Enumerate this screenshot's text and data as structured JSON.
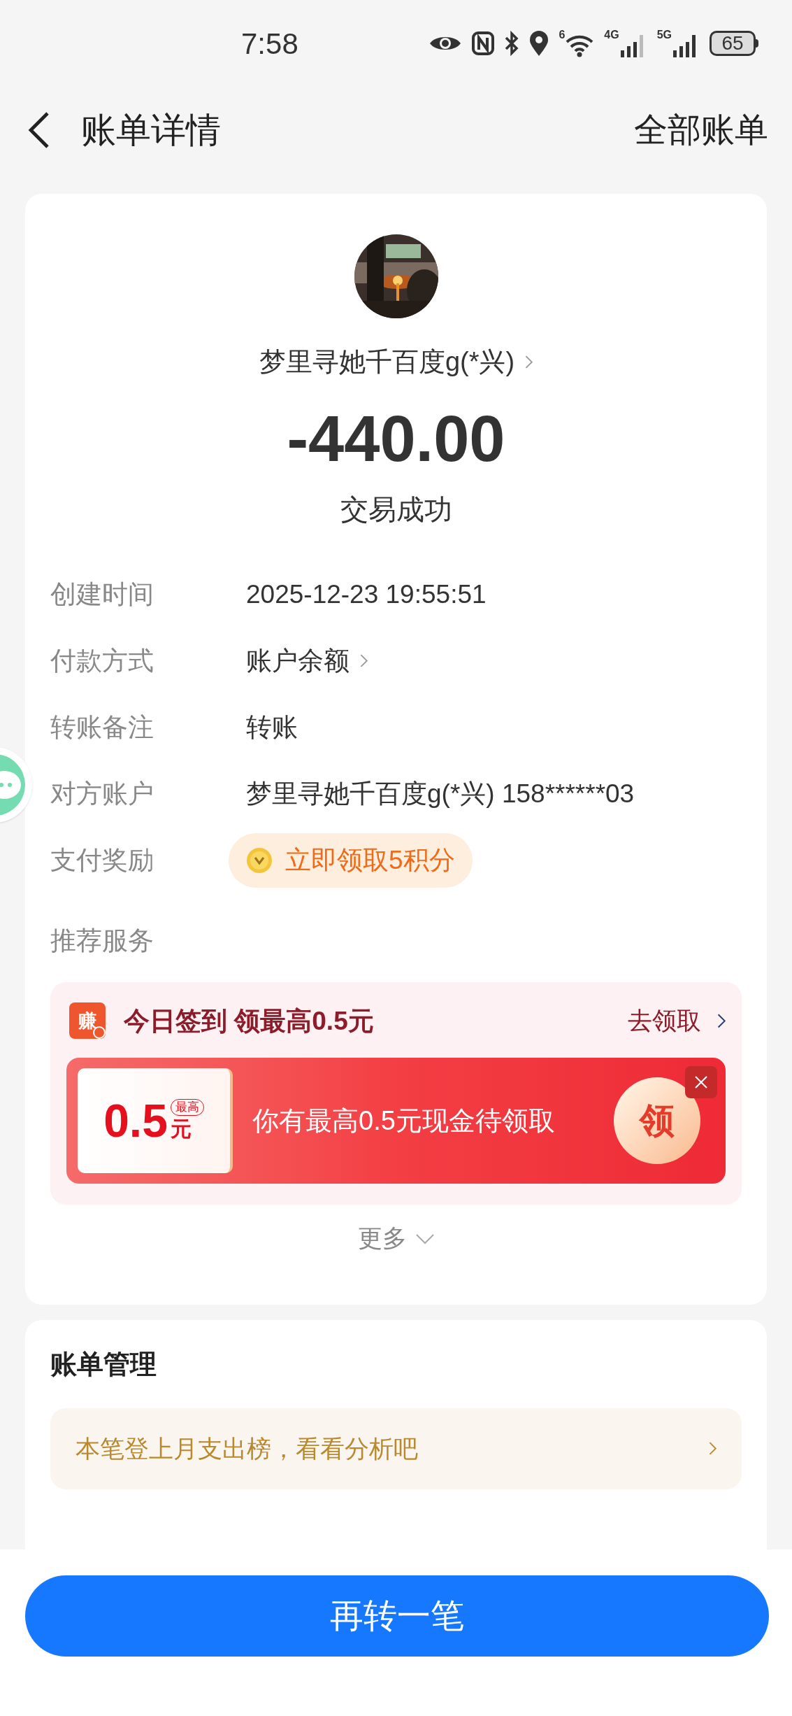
{
  "status_bar": {
    "time": "7:58",
    "wifi_label": "6",
    "cell_labels": [
      "4G",
      "5G"
    ],
    "battery": "65"
  },
  "header": {
    "title": "账单详情",
    "right_link": "全部账单"
  },
  "payee": {
    "name": "梦里寻她千百度g(*兴)",
    "amount": "-440.00",
    "status": "交易成功"
  },
  "details": [
    {
      "label": "创建时间",
      "value": "2025-12-23 19:55:51",
      "kind": "text"
    },
    {
      "label": "付款方式",
      "value": "账户余额",
      "kind": "link"
    },
    {
      "label": "转账备注",
      "value": "转账",
      "kind": "text"
    },
    {
      "label": "对方账户",
      "value": "梦里寻她千百度g(*兴) 158******03",
      "kind": "text"
    },
    {
      "label": "支付奖励",
      "value": "立即领取5积分",
      "kind": "reward"
    }
  ],
  "recommended": {
    "label": "推荐服务",
    "checkin_title": "今日签到 领最高0.5元",
    "checkin_action": "去领取",
    "icon_char": "赚",
    "banner": {
      "amount": "0.5",
      "badge": "最高",
      "unit": "元",
      "text": "你有最高0.5元现金待领取",
      "button": "领"
    },
    "more": "更多"
  },
  "bill_management": {
    "title": "账单管理",
    "tip": "本笔登上月支出榜，看看分析吧"
  },
  "bottom_button": "再转一笔"
}
